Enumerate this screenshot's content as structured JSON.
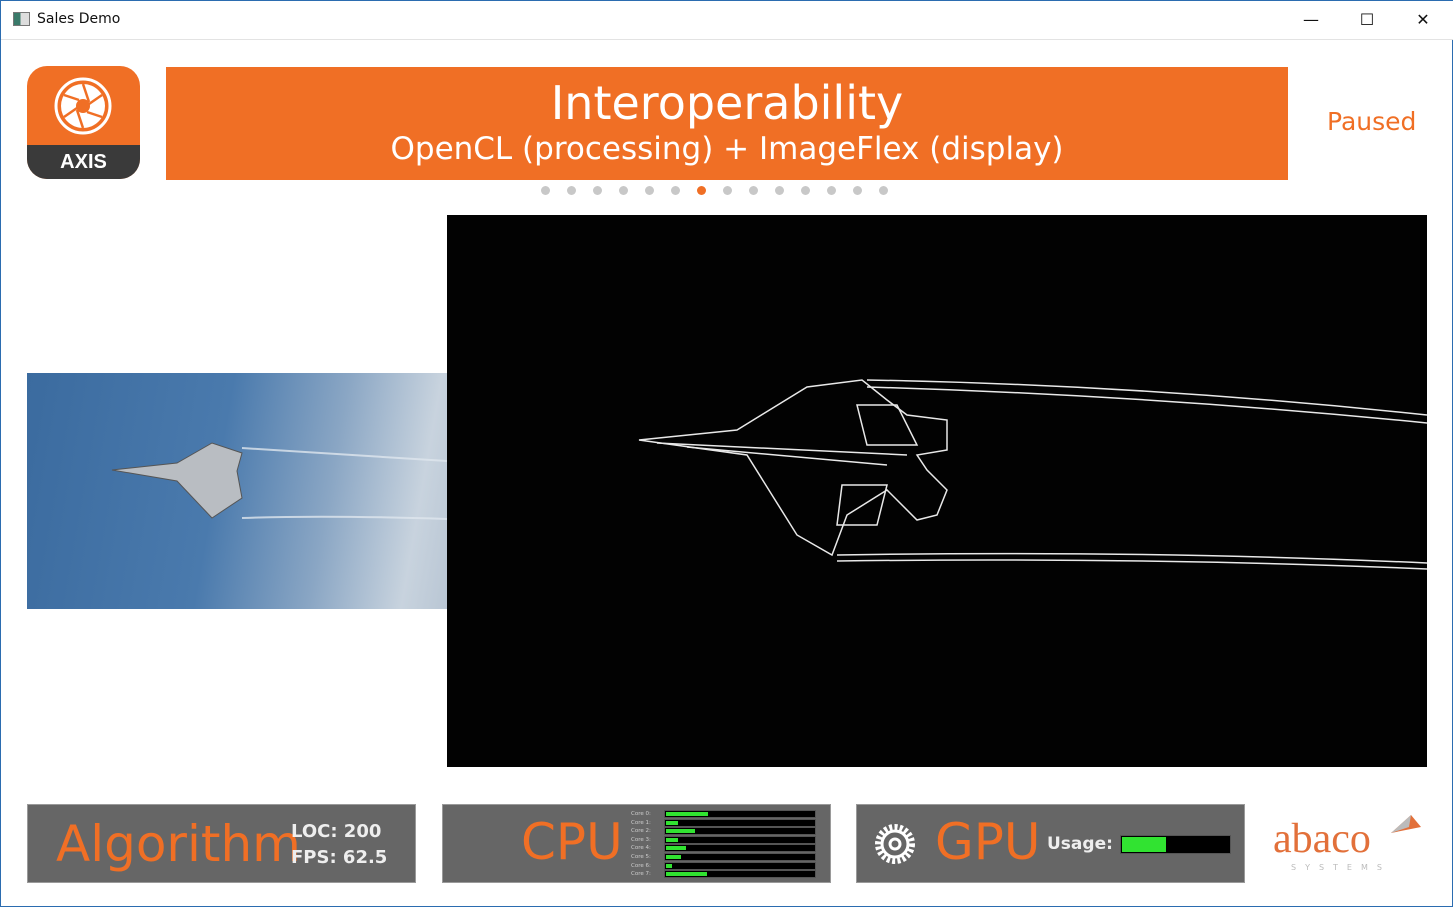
{
  "window": {
    "title": "Sales Demo",
    "minimize": "—",
    "maximize": "☐",
    "close": "✕"
  },
  "logo": {
    "text": "AXIS"
  },
  "banner": {
    "title": "Interoperability",
    "subtitle": "OpenCL (processing) + ImageFlex (display)"
  },
  "status": "Paused",
  "pager": {
    "count": 14,
    "active_index": 6
  },
  "algorithm": {
    "label": "Algorithm",
    "loc": "LOC: 200",
    "fps": "FPS: 62.5"
  },
  "cpu": {
    "label": "CPU",
    "cores": [
      {
        "name": "Core 0:",
        "usage": 0.28
      },
      {
        "name": "Core 1:",
        "usage": 0.08
      },
      {
        "name": "Core 2:",
        "usage": 0.19
      },
      {
        "name": "Core 3:",
        "usage": 0.08
      },
      {
        "name": "Core 4:",
        "usage": 0.13
      },
      {
        "name": "Core 5:",
        "usage": 0.1
      },
      {
        "name": "Core 6:",
        "usage": 0.04
      },
      {
        "name": "Core 7:",
        "usage": 0.27
      }
    ]
  },
  "gpu": {
    "label": "GPU",
    "usage_label": "Usage:",
    "usage": 0.4,
    "icon": "gear-icon"
  },
  "brand": {
    "name": "abaco",
    "sub": "SYSTEMS"
  },
  "colors": {
    "accent": "#f06f25",
    "bar": "#31e331",
    "panel": "#666666"
  }
}
